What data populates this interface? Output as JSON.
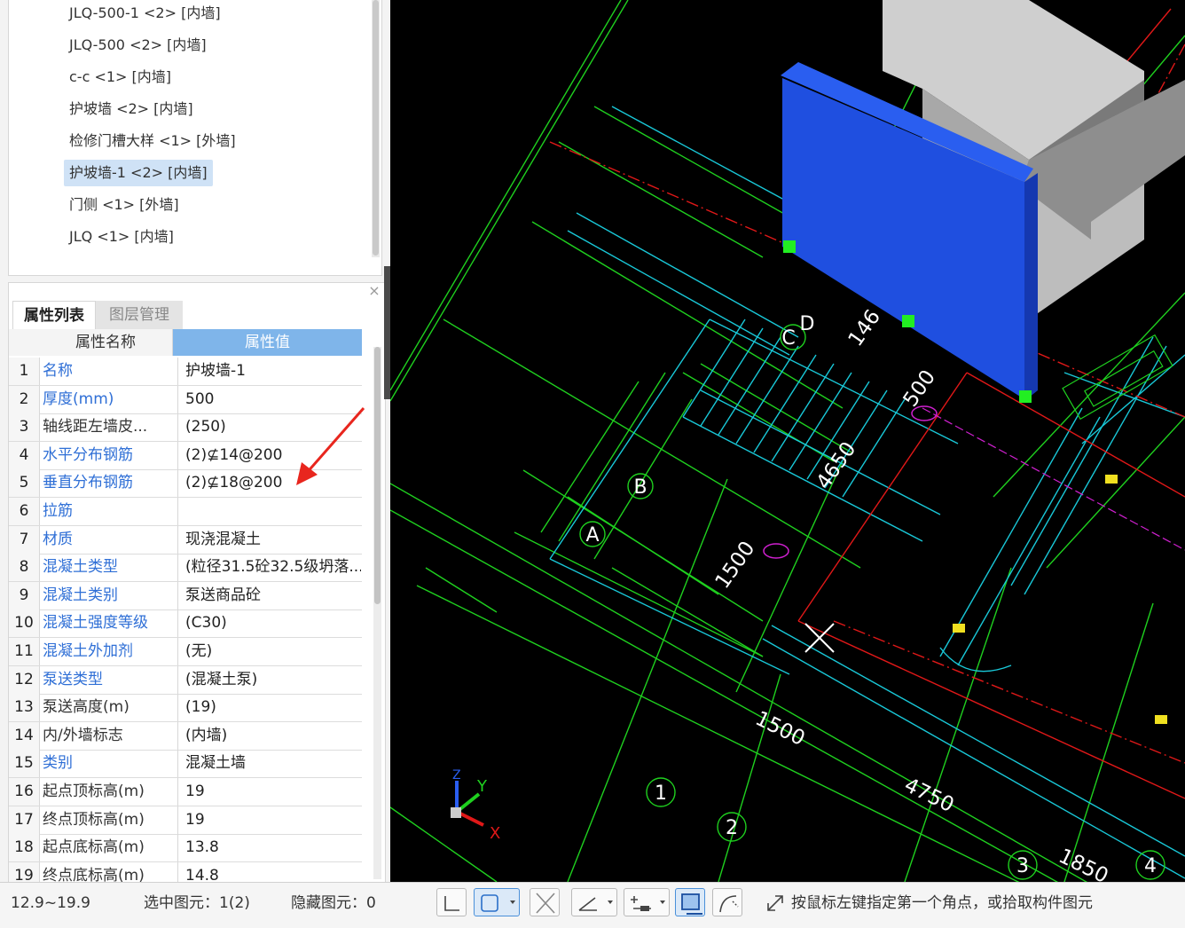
{
  "tree": {
    "items": [
      {
        "label": "JLQ-500-1 <2> [内墙]",
        "selected": false
      },
      {
        "label": "JLQ-500 <2> [内墙]",
        "selected": false
      },
      {
        "label": "c-c <1> [内墙]",
        "selected": false
      },
      {
        "label": "护坡墙 <2> [内墙]",
        "selected": false
      },
      {
        "label": "检修门槽大样 <1> [外墙]",
        "selected": false
      },
      {
        "label": "护坡墙-1 <2> [内墙]",
        "selected": true
      },
      {
        "label": "门侧 <1> [外墙]",
        "selected": false
      },
      {
        "label": "JLQ <1> [内墙]",
        "selected": false
      }
    ]
  },
  "props": {
    "close_icon": "close-icon",
    "tabs": [
      {
        "label": "属性列表",
        "active": true
      },
      {
        "label": "图层管理",
        "active": false
      }
    ],
    "header": {
      "name": "属性名称",
      "value": "属性值"
    },
    "rows": [
      {
        "idx": "1",
        "name": "名称",
        "value": "护坡墙-1",
        "blue": true
      },
      {
        "idx": "2",
        "name": "厚度(mm)",
        "value": "500",
        "blue": true
      },
      {
        "idx": "3",
        "name": "轴线距左墙皮...",
        "value": "(250)",
        "blue": false
      },
      {
        "idx": "4",
        "name": "水平分布钢筋",
        "value": "(2)⊈14@200",
        "blue": true
      },
      {
        "idx": "5",
        "name": "垂直分布钢筋",
        "value": "(2)⊈18@200",
        "blue": true
      },
      {
        "idx": "6",
        "name": "拉筋",
        "value": "",
        "blue": true
      },
      {
        "idx": "7",
        "name": "材质",
        "value": "现浇混凝土",
        "blue": true
      },
      {
        "idx": "8",
        "name": "混凝土类型",
        "value": "(粒径31.5砼32.5级坍落...",
        "blue": true
      },
      {
        "idx": "9",
        "name": "混凝土类别",
        "value": "泵送商品砼",
        "blue": true
      },
      {
        "idx": "10",
        "name": "混凝土强度等级",
        "value": "(C30)",
        "blue": true
      },
      {
        "idx": "11",
        "name": "混凝土外加剂",
        "value": "(无)",
        "blue": true
      },
      {
        "idx": "12",
        "name": "泵送类型",
        "value": "(混凝土泵)",
        "blue": true
      },
      {
        "idx": "13",
        "name": "泵送高度(m)",
        "value": "(19)",
        "blue": false
      },
      {
        "idx": "14",
        "name": "内/外墙标志",
        "value": "(内墙)",
        "blue": false
      },
      {
        "idx": "15",
        "name": "类别",
        "value": "混凝土墙",
        "blue": true
      },
      {
        "idx": "16",
        "name": "起点顶标高(m)",
        "value": "19",
        "blue": false
      },
      {
        "idx": "17",
        "name": "终点顶标高(m)",
        "value": "19",
        "blue": false
      },
      {
        "idx": "18",
        "name": "起点底标高(m)",
        "value": "13.8",
        "blue": false
      },
      {
        "idx": "19",
        "name": "终点底标高(m)",
        "value": "14.8",
        "blue": false
      }
    ]
  },
  "canvas": {
    "dimensions": [
      "146",
      "500",
      "4650",
      "1500",
      "1500",
      "4750",
      "1850"
    ],
    "axis_labels": [
      "A",
      "B",
      "C",
      "D",
      "1",
      "2",
      "3",
      "4"
    ],
    "gizmo": {
      "x": "X",
      "y": "Y",
      "z": "Z"
    },
    "colors": {
      "background": "#000000",
      "wall_blue": "#1f4fe0",
      "cyan": "#19c8d8",
      "green": "#1fd01f",
      "red": "#e01818",
      "grip": "#22ee22"
    }
  },
  "statusbar": {
    "elevation": "12.9~19.9",
    "selected": "选中图元：1(2)",
    "hidden": "隐藏图元：0",
    "tools": [
      "ortho-icon",
      "snap-box-icon",
      "cross-icon",
      "angle-icon",
      "offset-icon",
      "dynamic-input-icon",
      "arc-icon"
    ],
    "hint_icon": "expand-arrow-icon",
    "hint": "按鼠标左键指定第一个角点，或拾取构件图元"
  }
}
